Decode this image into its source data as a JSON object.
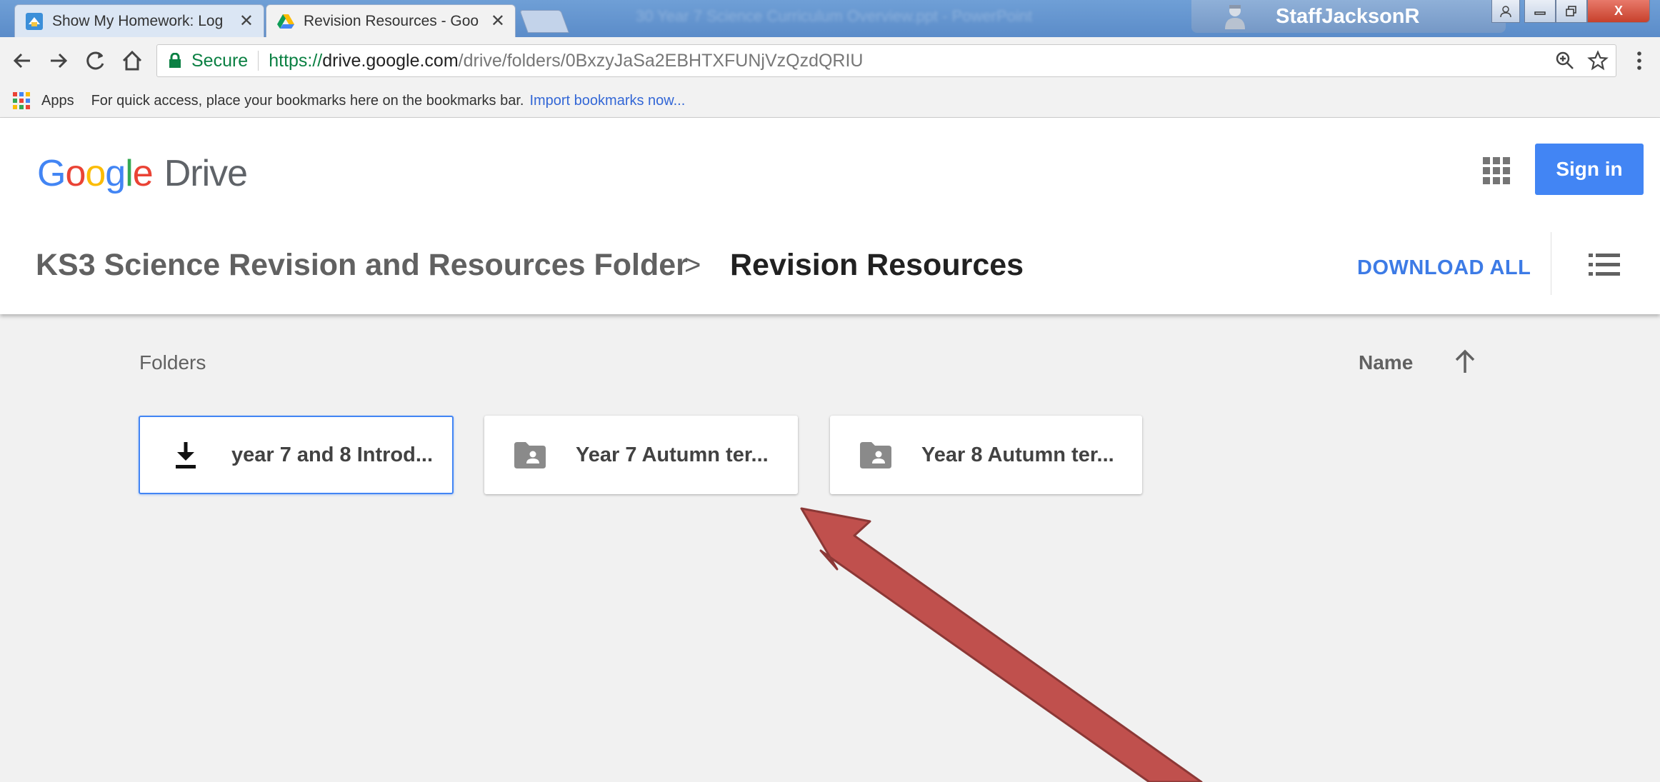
{
  "browser": {
    "tabs": [
      {
        "title": "Show My Homework: Log",
        "icon": "homework-favicon"
      },
      {
        "title": "Revision Resources - Goo",
        "icon": "drive-favicon",
        "active": true
      }
    ],
    "background_window_title": "30 Year 7 Science Curriculum Overview.ppt - PowerPoint",
    "profile_name": "StaffJacksonR",
    "window_controls": {
      "close": "X"
    },
    "omnibox": {
      "secure_label": "Secure",
      "url_protocol": "https://",
      "url_host": "drive.google.com",
      "url_path": "/drive/folders/0BxzyJaSa2EBHTXFUNjVzQzdQRIU"
    },
    "bookmarks_bar": {
      "apps_label": "Apps",
      "hint": "For quick access, place your bookmarks here on the bookmarks bar.",
      "import_link": "Import bookmarks now..."
    }
  },
  "drive": {
    "logo": {
      "google": "Google",
      "product": "Drive"
    },
    "sign_in_label": "Sign in",
    "breadcrumb": {
      "parent": "KS3 Science Revision and Resources Folder",
      "separator": ">",
      "current": "Revision Resources"
    },
    "download_all_label": "DOWNLOAD ALL",
    "section_label": "Folders",
    "sort": {
      "label": "Name",
      "direction": "ascending"
    },
    "folders": [
      {
        "name": "year 7 and 8 Introd...",
        "icon": "download-icon",
        "selected": true
      },
      {
        "name": "Year 7 Autumn ter...",
        "icon": "shared-folder-icon",
        "selected": false
      },
      {
        "name": "Year 8 Autumn ter...",
        "icon": "shared-folder-icon",
        "selected": false
      }
    ]
  },
  "colors": {
    "accent_blue": "#4285f4",
    "link_blue": "#3d7be6",
    "secure_green": "#0b8043",
    "annotation_arrow": "#c0504d",
    "page_background": "#f1f1f1"
  }
}
